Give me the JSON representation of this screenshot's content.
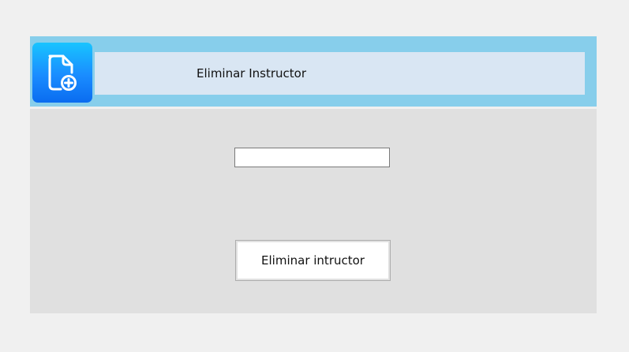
{
  "header": {
    "title": "Eliminar Instructor",
    "icon": "add-document-icon",
    "accent_color": "#87ceeb",
    "icon_gradient": [
      "#18c4ff",
      "#0a6cf0"
    ]
  },
  "form": {
    "input_value": "",
    "submit_label": "Eliminar intructor"
  }
}
